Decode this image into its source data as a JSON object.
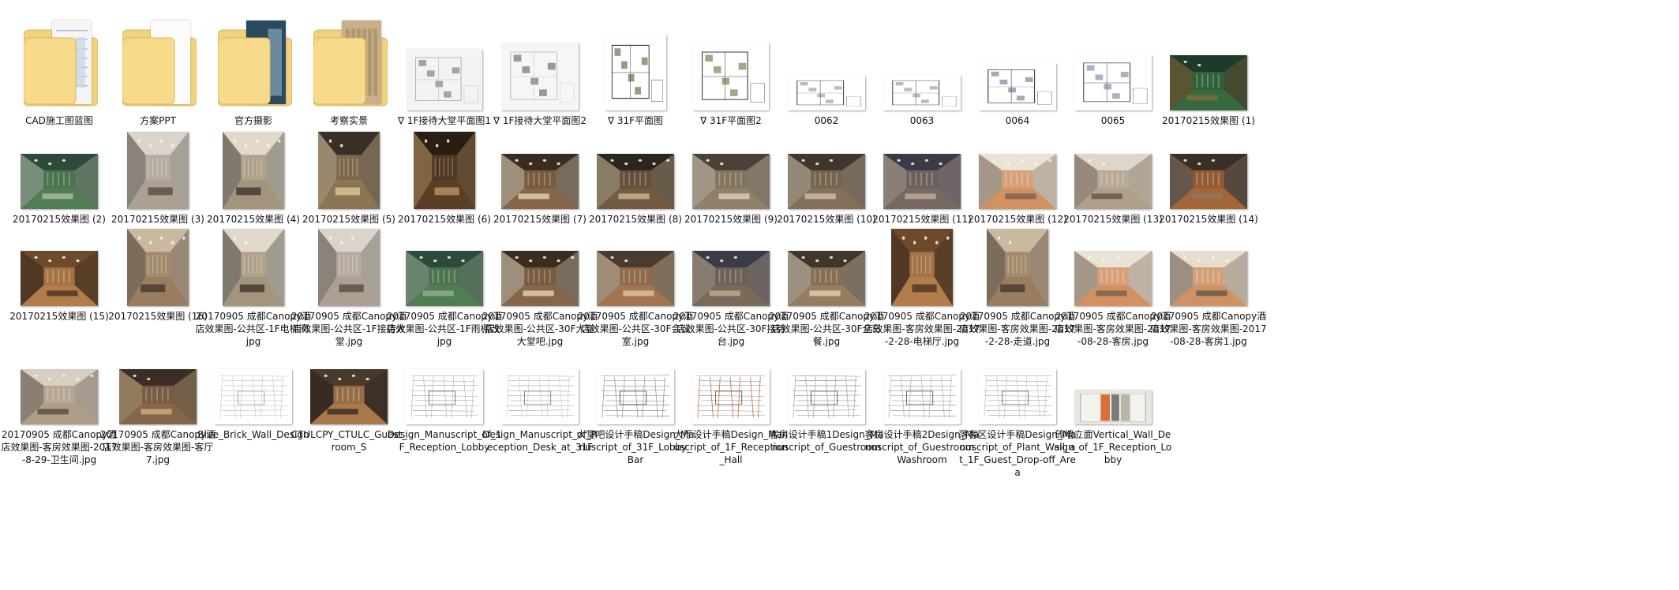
{
  "items": [
    {
      "label": "CAD施工图蓝图",
      "kind": "folder",
      "paper": "plan"
    },
    {
      "label": "方案PPT",
      "kind": "folder",
      "paper": "ppt"
    },
    {
      "label": "官方摄影",
      "kind": "folder",
      "paper": "photo"
    },
    {
      "label": "考察实景",
      "kind": "folder",
      "paper": "wall"
    },
    {
      "label": "∇ 1F接待大堂平面图1",
      "kind": "plan",
      "palette": [
        "#f3f3f3",
        "#8a8a8a",
        "#b7b7b7"
      ]
    },
    {
      "label": "∇ 1F接待大堂平面图2",
      "kind": "plan",
      "palette": [
        "#f6f6f6",
        "#7a7a7a",
        "#c5c5c5"
      ]
    },
    {
      "label": "∇ 31F平面图",
      "kind": "plan",
      "palette": [
        "#ffffff",
        "#6e7d5a",
        "#333333"
      ]
    },
    {
      "label": "∇ 31F平面图2",
      "kind": "plan",
      "palette": [
        "#ffffff",
        "#7e8f5e",
        "#444444"
      ]
    },
    {
      "label": "0062",
      "kind": "plan",
      "palette": [
        "#ffffff",
        "#9aa7b5",
        "#555555"
      ]
    },
    {
      "label": "0063",
      "kind": "plan",
      "palette": [
        "#ffffff",
        "#9aa7b5",
        "#555555"
      ]
    },
    {
      "label": "0064",
      "kind": "plan",
      "palette": [
        "#ffffff",
        "#7f8fa5",
        "#444444"
      ]
    },
    {
      "label": "0065",
      "kind": "plan",
      "palette": [
        "#ffffff",
        "#8e9aab",
        "#555555"
      ]
    },
    {
      "label": "20170215效果图 (1)",
      "kind": "render",
      "palette": [
        "#1d3a2a",
        "#3f7a45",
        "#8b6b3a"
      ]
    },
    {
      "label": "20170215效果图 (2)",
      "kind": "render",
      "palette": [
        "#2e4a3a",
        "#5d8f5c",
        "#b7c5b0"
      ]
    },
    {
      "label": "20170215效果图 (3)",
      "kind": "render",
      "palette": [
        "#d9d4cc",
        "#9c8f80",
        "#4a4038"
      ]
    },
    {
      "label": "20170215效果图 (4)",
      "kind": "render",
      "palette": [
        "#e1d9c9",
        "#8f7c62",
        "#2f2a24"
      ]
    },
    {
      "label": "20170215效果图 (5)",
      "kind": "render",
      "palette": [
        "#3a2f26",
        "#a88d63",
        "#e5d2a8"
      ]
    },
    {
      "label": "20170215效果图 (6)",
      "kind": "render",
      "palette": [
        "#2a1e14",
        "#6b4a2c",
        "#c9a06a"
      ]
    },
    {
      "label": "20170215效果图 (7)",
      "kind": "render",
      "palette": [
        "#3b2c22",
        "#a07a55",
        "#efe1c6"
      ]
    },
    {
      "label": "20170215效果图 (8)",
      "kind": "render",
      "palette": [
        "#2b2620",
        "#8b6d4b",
        "#d7c29c"
      ]
    },
    {
      "label": "20170215效果图 (9)",
      "kind": "render",
      "palette": [
        "#4a4238",
        "#a89679",
        "#e8dcc5"
      ]
    },
    {
      "label": "20170215效果图 (10)",
      "kind": "render",
      "palette": [
        "#3f362e",
        "#9a8468",
        "#d9cab0"
      ]
    },
    {
      "label": "20170215效果图 (11)",
      "kind": "render",
      "palette": [
        "#3c3a4a",
        "#8b7a6a",
        "#c9b79e"
      ]
    },
    {
      "label": "20170215效果图 (12)",
      "kind": "render",
      "palette": [
        "#e9e2d6",
        "#c9753a",
        "#6e5a48"
      ]
    },
    {
      "label": "20170215效果图 (13)",
      "kind": "render",
      "palette": [
        "#ddd6ca",
        "#a08c73",
        "#5b4c3c"
      ]
    },
    {
      "label": "20170215效果图 (14)",
      "kind": "render",
      "palette": [
        "#3a2e26",
        "#c97a3e",
        "#8a7a6a"
      ]
    },
    {
      "label": "20170215效果图 (15)",
      "kind": "render",
      "palette": [
        "#6b4a2e",
        "#c98d55",
        "#3a2a1e"
      ]
    },
    {
      "label": "20170215效果图 (16)",
      "kind": "render",
      "palette": [
        "#c9b9a0",
        "#8a6a4a",
        "#3b2e24"
      ]
    },
    {
      "label": "20170905 成都Canopy酒店效果图-公共区-1F电梯间.jpg",
      "kind": "render",
      "palette": [
        "#e1d9c9",
        "#8f7c62",
        "#2f2a24"
      ]
    },
    {
      "label": "20170905 成都Canopy酒店效果图-公共区-1F接待大堂.jpg",
      "kind": "render",
      "palette": [
        "#d9d4cc",
        "#9c8f80",
        "#4a4038"
      ]
    },
    {
      "label": "20170905 成都Canopy酒店效果图-公共区-1F雨棚改.jpg",
      "kind": "render",
      "palette": [
        "#2e4a3a",
        "#5d8f5c",
        "#9fb59a"
      ]
    },
    {
      "label": "20170905 成都Canopy酒店效果图-公共区-30F大堂大堂吧.jpg",
      "kind": "render",
      "palette": [
        "#3b2c22",
        "#a07a55",
        "#efe1c6"
      ]
    },
    {
      "label": "20170905 成都Canopy酒店效果图-公共区-30F会议室.jpg",
      "kind": "render",
      "palette": [
        "#4a3a30",
        "#c08a5a",
        "#e6d0b0"
      ]
    },
    {
      "label": "20170905 成都Canopy酒店效果图-公共区-30F接待台.jpg",
      "kind": "render",
      "palette": [
        "#3a3a48",
        "#8f7a62",
        "#c9b38e"
      ]
    },
    {
      "label": "20170905 成都Canopy酒店效果图-公共区-30F全日餐.jpg",
      "kind": "render",
      "palette": [
        "#3f362e",
        "#b59570",
        "#e9dcc3"
      ]
    },
    {
      "label": "20170905 成都Canopy酒店效果图-客房效果图-2017-2-28-电梯厅.jpg",
      "kind": "render",
      "palette": [
        "#6b4a2e",
        "#c98d55",
        "#3a2a1e"
      ]
    },
    {
      "label": "20170905 成都Canopy酒店效果图-客房效果图-2017-2-28-走道.jpg",
      "kind": "render",
      "palette": [
        "#c9b9a0",
        "#8a6a4a",
        "#3b2e24"
      ]
    },
    {
      "label": "20170905 成都Canopy酒店效果图-客房效果图-2017-08-28-客房.jpg",
      "kind": "render",
      "palette": [
        "#e9e2d6",
        "#c9753a",
        "#6e5a48"
      ]
    },
    {
      "label": "20170905 成都Canopy酒店效果图-客房效果图-2017-08-28-客房1.jpg",
      "kind": "render",
      "palette": [
        "#e6ddd0",
        "#c67a40",
        "#5e4e40"
      ]
    },
    {
      "label": "20170905 成都Canopy酒店效果图-客房效果图-2017-8-29-卫生间.jpg",
      "kind": "render",
      "palette": [
        "#d6cec2",
        "#a08c73",
        "#4b3e32"
      ]
    },
    {
      "label": "20170905 成都Canopy酒店效果图-客房效果图-客厅7.jpg",
      "kind": "render",
      "palette": [
        "#3a2e26",
        "#a07a55",
        "#d9b98a"
      ]
    },
    {
      "label": "Blue_Brick_Wall_Design",
      "kind": "sketch",
      "palette": [
        "#ffffff",
        "#8a8a8a",
        "#cfcfcf"
      ]
    },
    {
      "label": "CTULCPY_CTULC_Guest_room_S",
      "kind": "render",
      "palette": [
        "#4a3a2e",
        "#c98d55",
        "#2a201a"
      ]
    },
    {
      "label": "Design_Manuscript_of_1F_Reception_Lobby",
      "kind": "sketch",
      "palette": [
        "#ffffff",
        "#555555",
        "#bdbdbd"
      ]
    },
    {
      "label": "Design_Manuscript_of_Reception_Desk_at_31F",
      "kind": "sketch",
      "palette": [
        "#ffffff",
        "#666666",
        "#d0d0d0"
      ]
    },
    {
      "label": "大堂吧设计手稿Design_Manuscript_of_31F_Lobby_Bar",
      "kind": "sketch",
      "palette": [
        "#ffffff",
        "#333333",
        "#9a9a9a"
      ]
    },
    {
      "label": "大厅设计手稿Design_Manuscript_of_1F_Reception_Hall",
      "kind": "sketch",
      "palette": [
        "#ffffff",
        "#444444",
        "#c96a3a"
      ]
    },
    {
      "label": "客房设计手稿1Design_Manuscript_of_Guestroom",
      "kind": "sketch",
      "palette": [
        "#ffffff",
        "#333333",
        "#a8a8a8"
      ]
    },
    {
      "label": "客房设计手稿2Design_Manuscript_of_Guestroom_Washroom",
      "kind": "sketch",
      "palette": [
        "#ffffff",
        "#444444",
        "#b5b5b5"
      ]
    },
    {
      "label": "落客区设计手稿Design_Manuscript_of_Plant_Wall_at_1F_Guest_Drop-off_Area",
      "kind": "sketch",
      "palette": [
        "#ffffff",
        "#555555",
        "#c7c7c7"
      ]
    },
    {
      "label": "砖墙立面Vertical_Wall_Design_of_1F_Reception_Lobby",
      "kind": "wallpanel",
      "palette": [
        "#e9e6e0",
        "#d4703a",
        "#7a7a7a"
      ]
    }
  ]
}
